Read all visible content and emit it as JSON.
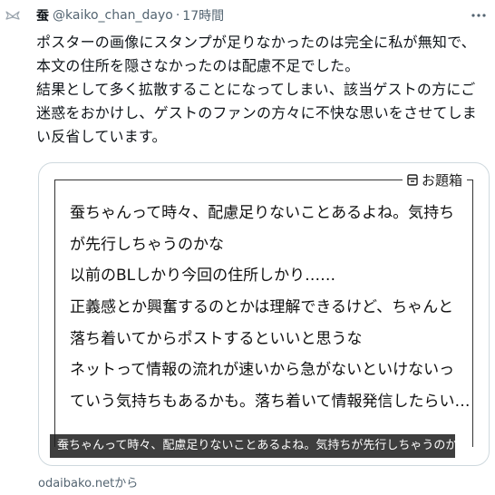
{
  "post": {
    "display_name": "蚕",
    "handle": "@kaiko_chan_dayo",
    "separator": "·",
    "time": "17時間",
    "icons": {
      "avatar": "bird-avatar-icon",
      "more": "more-dots-icon",
      "odai_box": "box-icon"
    },
    "body": [
      "ポスターの画像にスタンプが足りなかったのは完全に私が無知で、本文の住所を隠さなかったのは配慮不足でした。",
      "結果として多く拡散することになってしまい、該当ゲストの方にご迷惑をおかけし、ゲストのファンの方々に不快な思いをさせてしまい反省しています。"
    ]
  },
  "card": {
    "label": "お題箱",
    "question_lines": [
      "蚕ちゃんって時々、配慮足りないことあるよね。気持ち",
      "が先行しちゃうのかな",
      "以前のBLしかり今回の住所しかり……",
      "正義感とか興奮するのとかは理解できるけど、ちゃんと",
      "落ち着いてからポストするといいと思うな",
      "ネットって情報の流れが速いから急がないといけないっ",
      "ていう気持ちもあるかも。落ち着いて情報発信したらい…"
    ],
    "caption": "蚕ちゃんって時々、配慮足りないことあるよね。気持ちが先行しちゃうのかな ...",
    "source": "odaibako.netから"
  },
  "colors": {
    "text": "#0f1419",
    "secondary": "#536471",
    "card_border": "#cfd9de",
    "caption_bg": "#1e1e1e"
  }
}
